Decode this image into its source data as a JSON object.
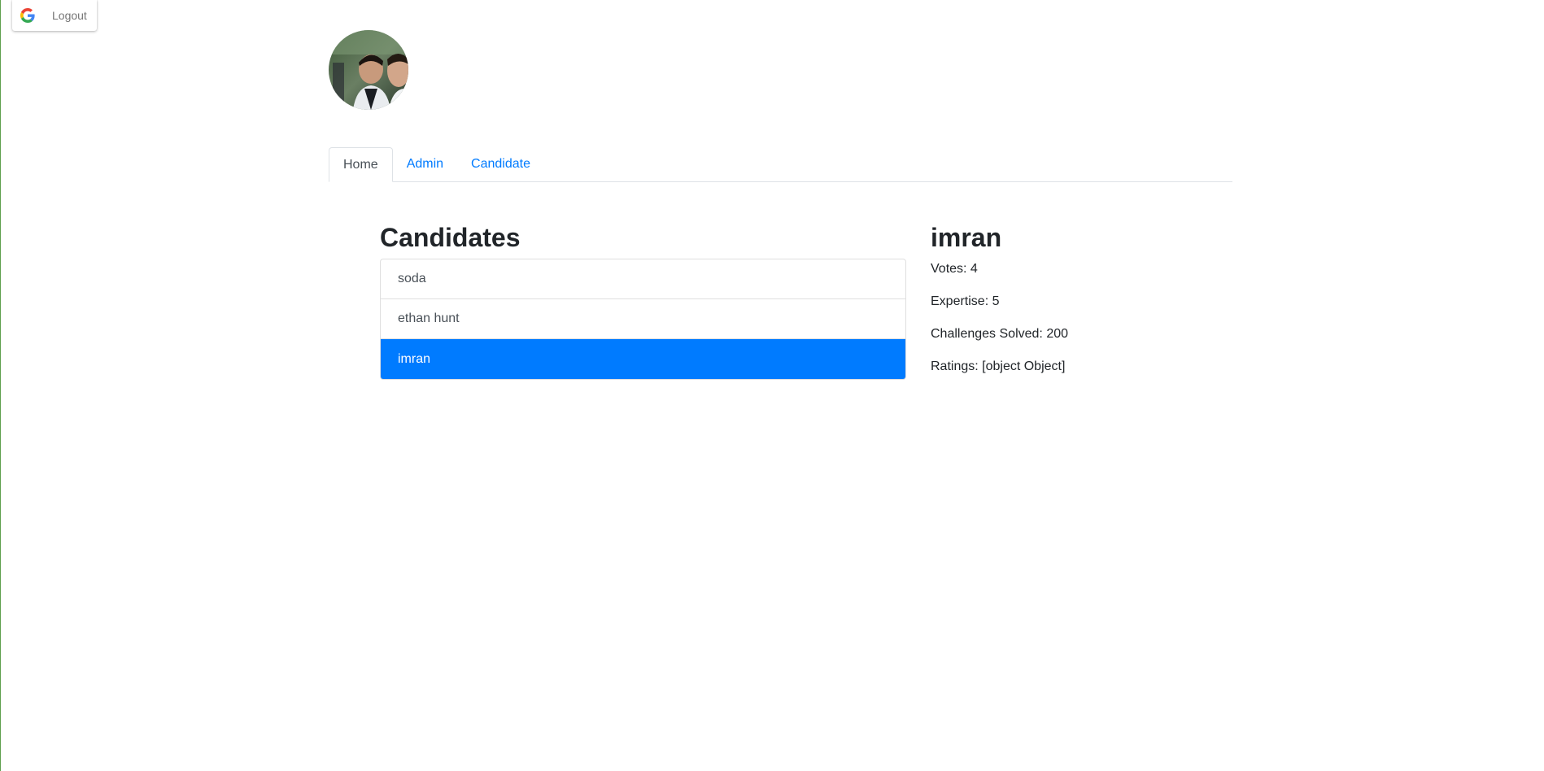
{
  "auth": {
    "logout_label": "Logout",
    "icon": "google-g-icon"
  },
  "profile": {
    "avatar_icon": "user-avatar-photo"
  },
  "tabs": [
    {
      "label": "Home",
      "active": true
    },
    {
      "label": "Admin",
      "active": false
    },
    {
      "label": "Candidate",
      "active": false
    }
  ],
  "candidates": {
    "title": "Candidates",
    "items": [
      {
        "name": "soda",
        "selected": false
      },
      {
        "name": "ethan hunt",
        "selected": false
      },
      {
        "name": "imran",
        "selected": true
      }
    ]
  },
  "detail": {
    "name": "imran",
    "votes": "Votes: 4",
    "expertise": "Expertise: 5",
    "challenges": "Challenges Solved: 200",
    "ratings": "Ratings: [object Object]"
  },
  "colors": {
    "primary": "#007bff",
    "left_edge": "#5fa04e"
  }
}
